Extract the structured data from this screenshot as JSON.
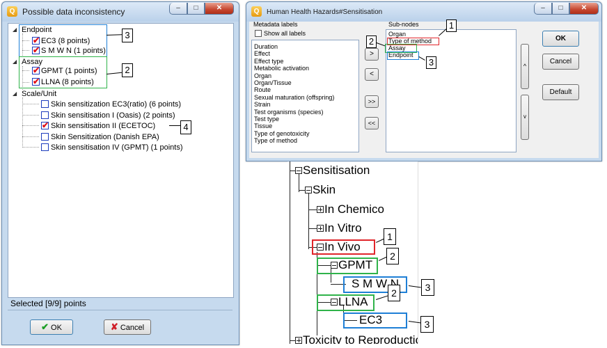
{
  "left_window": {
    "title": "Possible data inconsistency",
    "tree": [
      {
        "label": "Endpoint",
        "children": [
          {
            "label": "EC3 (8 points)",
            "checked": true
          },
          {
            "label": "S M W N (1 points)",
            "checked": true
          }
        ]
      },
      {
        "label": "Assay",
        "children": [
          {
            "label": "GPMT (1 points)",
            "checked": true
          },
          {
            "label": "LLNA (8 points)",
            "checked": true
          }
        ]
      },
      {
        "label": "Scale/Unit",
        "children": [
          {
            "label": "Skin sensitization EC3(ratio) (6 points)",
            "checked": false
          },
          {
            "label": "Skin sensitisation I (Oasis) (2 points)",
            "checked": false
          },
          {
            "label": "Skin sensitisation II (ECETOC)",
            "checked": true
          },
          {
            "label": "Skin Sensitization (Danish EPA)",
            "checked": false
          },
          {
            "label": "Skin sensitisation IV (GPMT) (1 points)",
            "checked": false
          }
        ]
      }
    ],
    "status": "Selected [9/9] points",
    "ok_label": "OK",
    "cancel_label": "Cancel"
  },
  "right_window": {
    "title": "Human Health Hazards#Sensitisation",
    "metadata_label": "Metadata labels",
    "show_all_label": "Show all labels",
    "metadata_items": [
      "Duration",
      "Effect",
      "Effect type",
      "Metabolic activation",
      "Organ",
      "Organ/Tissue",
      "Route",
      "Sexual maturation (offspring)",
      "Strain",
      "Test organisms (species)",
      "Test type",
      "Tissue",
      "Type of genotoxicity",
      "Type of method"
    ],
    "subnodes_label": "Sub-nodes",
    "subnodes_items": [
      "Organ",
      "Type of method",
      "Assay",
      "Endpoint"
    ],
    "move_buttons": [
      ">",
      "<",
      ">>",
      "<<"
    ],
    "up_label": "^",
    "down_label": "v",
    "ok_label": "OK",
    "cancel_label": "Cancel",
    "default_label": "Default"
  },
  "big_tree": {
    "nodes": [
      "Sensitisation",
      "Skin",
      "In Chemico",
      "In Vitro",
      "In Vivo",
      "GPMT",
      "S M W N",
      "LLNA",
      "EC3",
      "Toxicity to Reproduction"
    ]
  },
  "callouts": {
    "left_endpoint": "3",
    "left_assay": "2",
    "left_scale": "4",
    "dialog_type_of_method": "1",
    "dialog_assay": "2",
    "dialog_endpoint": "3",
    "tree_invivo": "1",
    "tree_gpmt": "2",
    "tree_smwn": "3",
    "tree_llna": "2",
    "tree_ec3": "3"
  },
  "colors": {
    "red": "#e0252a",
    "green": "#2fb34a",
    "blue": "#1e7fd6"
  },
  "icons": {
    "window_icon": "q-app-icon",
    "ok_icon": "green-checkmark-icon",
    "cancel_icon": "red-x-icon"
  }
}
